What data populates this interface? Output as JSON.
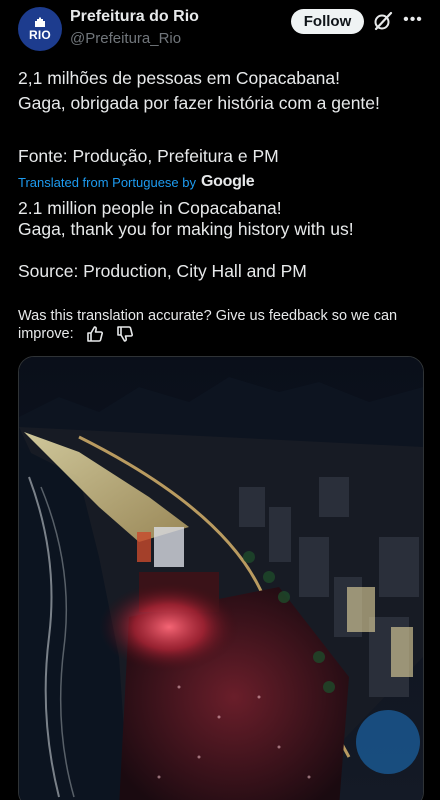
{
  "account": {
    "name": "Prefeitura do Rio",
    "handle": "@Prefeitura_Rio",
    "avatar_text": "RIO"
  },
  "header": {
    "follow_label": "Follow",
    "grok_icon": "grok-icon",
    "more_label": "•••"
  },
  "post": {
    "original_line1": "2,1 milhões de pessoas em Copacabana!",
    "original_line2": "Gaga, obrigada por fazer história com a gente!",
    "original_source": "Fonte: Produção, Prefeitura e PM",
    "translated_from": "Translated from Portuguese by",
    "translator_brand": "Google",
    "translated_line1": "2.1 million people in Copacabana!",
    "translated_line2": "Gaga, thank you for making history with us!",
    "translated_source": "Source: Production, City Hall and PM",
    "feedback_text": "Was this translation accurate? Give us feedback so we can improve:"
  },
  "media": {
    "description_icon": "concert-photo"
  },
  "colors": {
    "background": "#000000",
    "text": "#e7e9ea",
    "secondary": "#71767b",
    "link": "#1d9bf0",
    "avatar": "#1d3c8e"
  }
}
